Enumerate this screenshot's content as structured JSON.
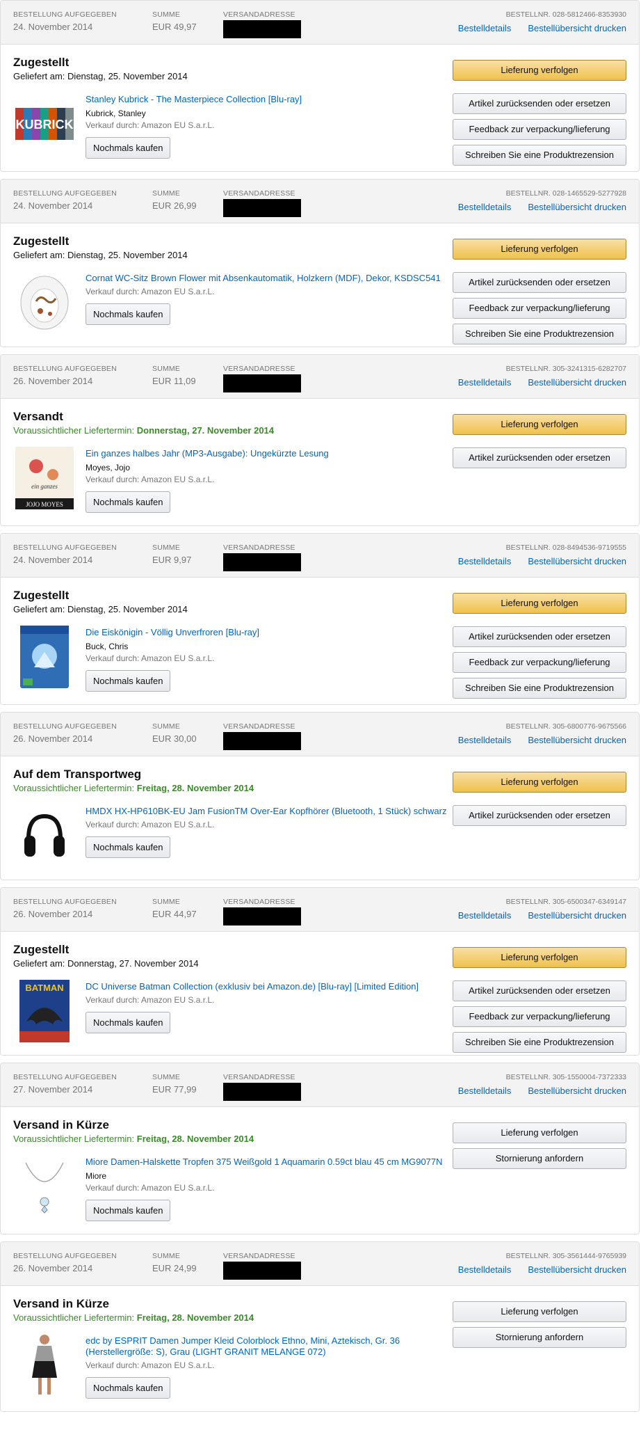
{
  "labels": {
    "placed": "BESTELLUNG AUFGEGEBEN",
    "total": "SUMME",
    "ship_to": "VERSANDADRESSE",
    "details": "Bestelldetails",
    "print": "Bestellübersicht drucken",
    "rebuy": "Nochmals kaufen",
    "track": "Lieferung verfolgen",
    "return": "Artikel zurücksenden oder ersetzen",
    "feedback": "Feedback zur verpackung/lieferung",
    "review": "Schreiben Sie eine Produktrezension",
    "cancel": "Stornierung anfordern"
  },
  "orders": [
    {
      "date": "24. November 2014",
      "total": "EUR 49,97",
      "order_no": "BESTELLNR. 028-5812466-8353930",
      "status": "Zugestellt",
      "sub_prefix": "Geliefert am:",
      "sub_value": "Dienstag, 25. November 2014",
      "sub_green": false,
      "item": {
        "title": "Stanley Kubrick - The Masterpiece Collection [Blu-ray]",
        "author": "Kubrick, Stanley",
        "seller": "Verkauf durch: Amazon EU S.a.r.L.",
        "thumb": "kubrick-box-icon"
      },
      "buttons": [
        "track",
        "return",
        "feedback",
        "review"
      ]
    },
    {
      "date": "24. November 2014",
      "total": "EUR 26,99",
      "order_no": "BESTELLNR. 028-1465529-5277928",
      "status": "Zugestellt",
      "sub_prefix": "Geliefert am:",
      "sub_value": "Dienstag, 25. November 2014",
      "sub_green": false,
      "item": {
        "title": "Cornat WC-Sitz Brown Flower mit Absenkautomatik, Holzkern (MDF), Dekor, KSDSC541",
        "author": "",
        "seller": "Verkauf durch: Amazon EU S.a.r.L.",
        "thumb": "toilet-seat-icon"
      },
      "buttons": [
        "track",
        "return",
        "feedback",
        "review"
      ]
    },
    {
      "date": "26. November 2014",
      "total": "EUR 11,09",
      "order_no": "BESTELLNR. 305-3241315-6282707",
      "status": "Versandt",
      "sub_prefix": "Voraussichtlicher Liefertermin:",
      "sub_value": "Donnerstag, 27. November 2014",
      "sub_green": true,
      "item": {
        "title": "Ein ganzes halbes Jahr (MP3-Ausgabe): Ungekürzte Lesung",
        "author": "Moyes, Jojo",
        "seller": "Verkauf durch: Amazon EU S.a.r.L.",
        "thumb": "audiobook-cover-icon"
      },
      "buttons": [
        "track",
        "return"
      ]
    },
    {
      "date": "24. November 2014",
      "total": "EUR 9,97",
      "order_no": "BESTELLNR. 028-8494536-9719555",
      "status": "Zugestellt",
      "sub_prefix": "Geliefert am:",
      "sub_value": "Dienstag, 25. November 2014",
      "sub_green": false,
      "item": {
        "title": "Die Eiskönigin - Völlig Unverfroren [Blu-ray]",
        "author": "Buck, Chris",
        "seller": "Verkauf durch: Amazon EU S.a.r.L.",
        "thumb": "bluray-cover-icon"
      },
      "buttons": [
        "track",
        "return",
        "feedback",
        "review"
      ]
    },
    {
      "date": "26. November 2014",
      "total": "EUR 30,00",
      "order_no": "BESTELLNR. 305-6800776-9675566",
      "status": "Auf dem Transportweg",
      "sub_prefix": "Voraussichtlicher Liefertermin:",
      "sub_value": "Freitag, 28. November 2014",
      "sub_green": true,
      "item": {
        "title": "HMDX HX-HP610BK-EU Jam FusionTM Over-Ear Kopfhörer (Bluetooth, 1 Stück) schwarz",
        "author": "",
        "seller": "Verkauf durch: Amazon EU S.a.r.L.",
        "thumb": "headphones-icon"
      },
      "buttons": [
        "track",
        "return"
      ]
    },
    {
      "date": "26. November 2014",
      "total": "EUR 44,97",
      "order_no": "BESTELLNR. 305-6500347-6349147",
      "status": "Zugestellt",
      "sub_prefix": "Geliefert am:",
      "sub_value": "Donnerstag, 27. November 2014",
      "sub_green": false,
      "item": {
        "title": "DC Universe Batman Collection (exklusiv bei Amazon.de) [Blu-ray] [Limited Edition]",
        "author": "",
        "seller": "Verkauf durch: Amazon EU S.a.r.L.",
        "thumb": "batman-cover-icon"
      },
      "buttons": [
        "track",
        "return",
        "feedback",
        "review"
      ]
    },
    {
      "date": "27. November 2014",
      "total": "EUR 77,99",
      "order_no": "BESTELLNR. 305-1550004-7372333",
      "status": "Versand in Kürze",
      "sub_prefix": "Voraussichtlicher Liefertermin:",
      "sub_value": "Freitag, 28. November 2014",
      "sub_green": true,
      "item": {
        "title": "Miore Damen-Halskette Tropfen 375 Weißgold 1 Aquamarin 0.59ct blau 45 cm MG9077N",
        "author": "Miore",
        "seller": "Verkauf durch: Amazon EU S.a.r.L.",
        "thumb": "necklace-icon"
      },
      "buttons": [
        "track_plain",
        "cancel"
      ]
    },
    {
      "date": "26. November 2014",
      "total": "EUR 24,99",
      "order_no": "BESTELLNR. 305-3561444-9765939",
      "status": "Versand in Kürze",
      "sub_prefix": "Voraussichtlicher Liefertermin:",
      "sub_value": "Freitag, 28. November 2014",
      "sub_green": true,
      "item": {
        "title": "edc by ESPRIT Damen Jumper Kleid Colorblock Ethno, Mini, Aztekisch, Gr. 36 (Herstellergröße: S), Grau (LIGHT GRANIT MELANGE 072)",
        "author": "",
        "seller": "Verkauf durch: Amazon EU S.a.r.L.",
        "thumb": "dress-icon"
      },
      "buttons": [
        "track_plain",
        "cancel"
      ]
    }
  ]
}
